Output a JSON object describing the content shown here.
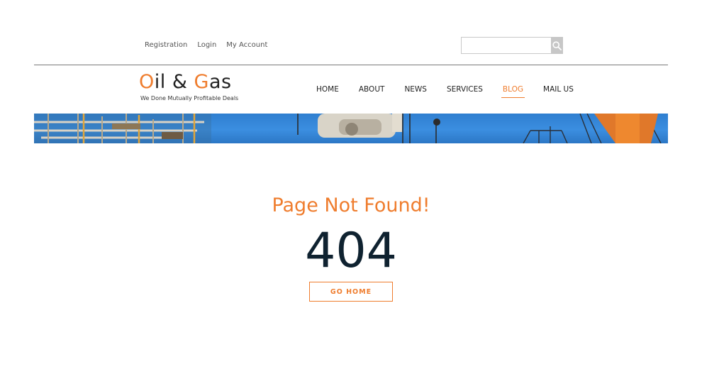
{
  "top_links": [
    "Registration",
    "Login",
    "My Account"
  ],
  "search": {
    "placeholder": "",
    "value": "",
    "icon": "search-icon"
  },
  "logo": {
    "first_letter": "O",
    "part1": "il & ",
    "second_letter": "G",
    "part2": "as",
    "tagline": "We Done Mutually Profitable Deals"
  },
  "nav": {
    "items": [
      "HOME",
      "ABOUT",
      "NEWS",
      "SERVICES",
      "BLOG",
      "MAIL US"
    ],
    "active": "BLOG"
  },
  "main": {
    "title": "Page Not Found!",
    "code": "404",
    "button_label": "GO HOME"
  },
  "colors": {
    "accent": "#ef7d2e",
    "dark": "#0f2230",
    "sky": "#3b8ee0"
  }
}
